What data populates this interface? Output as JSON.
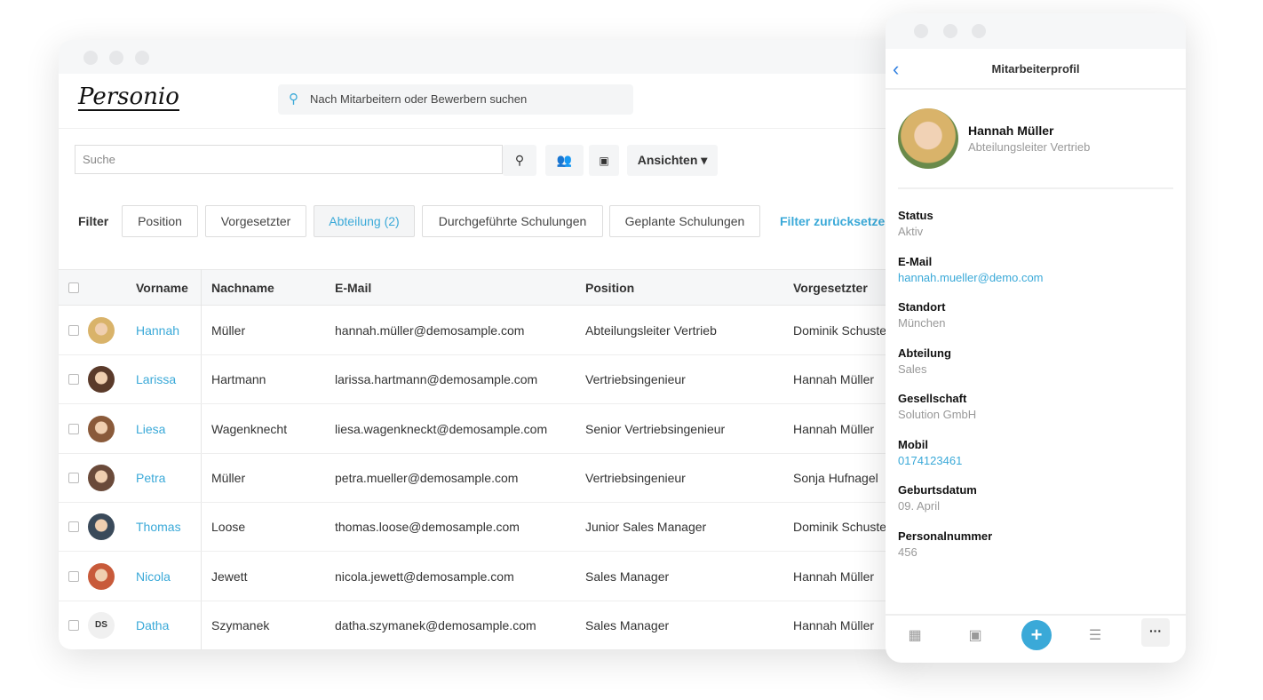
{
  "app": {
    "logo": "Personio",
    "global_search_placeholder": "Nach Mitarbeitern oder Bewerbern suchen"
  },
  "toolbar": {
    "search_placeholder": "Suche",
    "views_label": "Ansichten ▾"
  },
  "filters": {
    "label": "Filter",
    "chips": [
      "Position",
      "Vorgesetzter",
      "Abteilung (2)",
      "Durchgeführte Schulungen",
      "Geplante Schulungen"
    ],
    "active_chip": "Abteilung (2)",
    "reset": "Filter zurücksetzen"
  },
  "table": {
    "columns": [
      "Vorname",
      "Nachname",
      "E-Mail",
      "Position",
      "Vorgesetzter"
    ],
    "rows": [
      {
        "first": "Hannah",
        "last": "Müller",
        "email": "hannah.müller@demosample.com",
        "position": "Abteilungsleiter Vertrieb",
        "manager": "Dominik Schuster"
      },
      {
        "first": "Larissa",
        "last": "Hartmann",
        "email": "larissa.hartmann@demosample.com",
        "position": "Vertriebsingenieur",
        "manager": "Hannah Müller"
      },
      {
        "first": "Liesa",
        "last": "Wagenknecht",
        "email": "liesa.wagenkneckt@demosample.com",
        "position": "Senior Vertriebsingenieur",
        "manager": "Hannah Müller"
      },
      {
        "first": "Petra",
        "last": "Müller",
        "email": "petra.mueller@demosample.com",
        "position": "Vertriebsingenieur",
        "manager": "Sonja Hufnagel"
      },
      {
        "first": "Thomas",
        "last": "Loose",
        "email": "thomas.loose@demosample.com",
        "position": "Junior Sales Manager",
        "manager": "Dominik Schuster"
      },
      {
        "first": "Nicola",
        "last": "Jewett",
        "email": "nicola.jewett@demosample.com",
        "position": "Sales Manager",
        "manager": "Hannah Müller"
      },
      {
        "first": "Datha",
        "last": "Szymanek",
        "email": "datha.szymanek@demosample.com",
        "position": "Sales Manager",
        "manager": "Hannah Müller",
        "initials": "DS"
      }
    ]
  },
  "profile": {
    "title": "Mitarbeiterprofil",
    "name": "Hannah Müller",
    "role": "Abteilungsleiter Vertrieb",
    "fields": [
      {
        "label": "Status",
        "value": "Aktiv"
      },
      {
        "label": "E-Mail",
        "value": "hannah.mueller@demo.com"
      },
      {
        "label": "Standort",
        "value": "München"
      },
      {
        "label": "Abteilung",
        "value": "Sales"
      },
      {
        "label": "Gesellschaft",
        "value": "Solution GmbH"
      },
      {
        "label": "Mobil",
        "value": "0174123461"
      },
      {
        "label": "Geburtsdatum",
        "value": "09. April"
      },
      {
        "label": "Personalnummer",
        "value": "456"
      }
    ]
  },
  "colors": {
    "accent": "#3aa9d8",
    "back": "#2f7fe0"
  }
}
